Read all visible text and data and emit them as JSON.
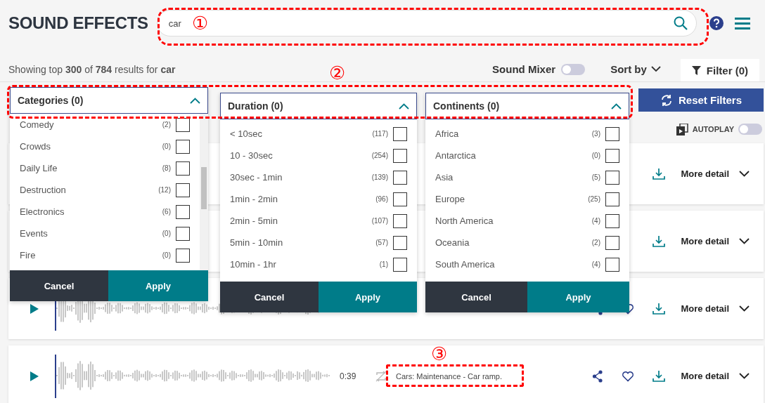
{
  "header": {
    "title": "SOUND EFFECTS",
    "search": {
      "value": "car"
    }
  },
  "results_summary": "Showing top **300** of **784** results for **car**",
  "toolbar": {
    "sound_mixer": {
      "label": "Sound Mixer",
      "on": false
    },
    "sort": "Sort by",
    "filter_tab": {
      "label": "Filter (0)",
      "selected": true
    }
  },
  "reset_button": "Reset Filters",
  "autoplay": {
    "label": "AUTOPLAY",
    "on": false
  },
  "filters": [
    {
      "title": "Categories (0)",
      "expanded": true,
      "scrollable": true,
      "items": [
        {
          "label": "Comedy",
          "count": "(2)",
          "checked": false
        },
        {
          "label": "Crowds",
          "count": "(0)",
          "checked": false
        },
        {
          "label": "Daily Life",
          "count": "(8)",
          "checked": false
        },
        {
          "label": "Destruction",
          "count": "(12)",
          "checked": false
        },
        {
          "label": "Electronics",
          "count": "(6)",
          "checked": false
        },
        {
          "label": "Events",
          "count": "(0)",
          "checked": false
        },
        {
          "label": "Fire",
          "count": "(0)",
          "checked": false
        }
      ],
      "buttons": [
        "Cancel",
        "Apply"
      ]
    },
    {
      "title": "Duration (0)",
      "expanded": true,
      "scrollable": false,
      "items": [
        {
          "label": "< 10sec",
          "count": "(117)",
          "checked": false
        },
        {
          "label": "10 - 30sec",
          "count": "(254)",
          "checked": false
        },
        {
          "label": "30sec - 1min",
          "count": "(139)",
          "checked": false
        },
        {
          "label": "1min - 2min",
          "count": "(96)",
          "checked": false
        },
        {
          "label": "2min - 5min",
          "count": "(107)",
          "checked": false
        },
        {
          "label": "5min - 10min",
          "count": "(57)",
          "checked": false
        },
        {
          "label": "10min - 1hr",
          "count": "(1)",
          "checked": false
        }
      ],
      "buttons": [
        "Cancel",
        "Apply"
      ]
    },
    {
      "title": "Continents (0)",
      "expanded": true,
      "scrollable": false,
      "items": [
        {
          "label": "Africa",
          "count": "(3)",
          "checked": false
        },
        {
          "label": "Antarctica",
          "count": "(0)",
          "checked": false
        },
        {
          "label": "Asia",
          "count": "(5)",
          "checked": false
        },
        {
          "label": "Europe",
          "count": "(25)",
          "checked": false
        },
        {
          "label": "North America",
          "count": "(4)",
          "checked": false
        },
        {
          "label": "Oceania",
          "count": "(2)",
          "checked": false
        },
        {
          "label": "South America",
          "count": "(4)",
          "checked": false
        }
      ],
      "buttons": [
        "Cancel",
        "Apply"
      ]
    }
  ],
  "results": [
    {
      "more": "More detail"
    },
    {
      "more": "More detail"
    },
    {
      "player": true,
      "share": true,
      "more": "More detail"
    },
    {
      "player": true,
      "duration": "0:39",
      "title": "Cars: Maintenance - Car ramp.",
      "share": true,
      "more": "More detail"
    }
  ],
  "annotations": [
    {
      "label": "①"
    },
    {
      "label": "②"
    },
    {
      "label": "③"
    }
  ]
}
